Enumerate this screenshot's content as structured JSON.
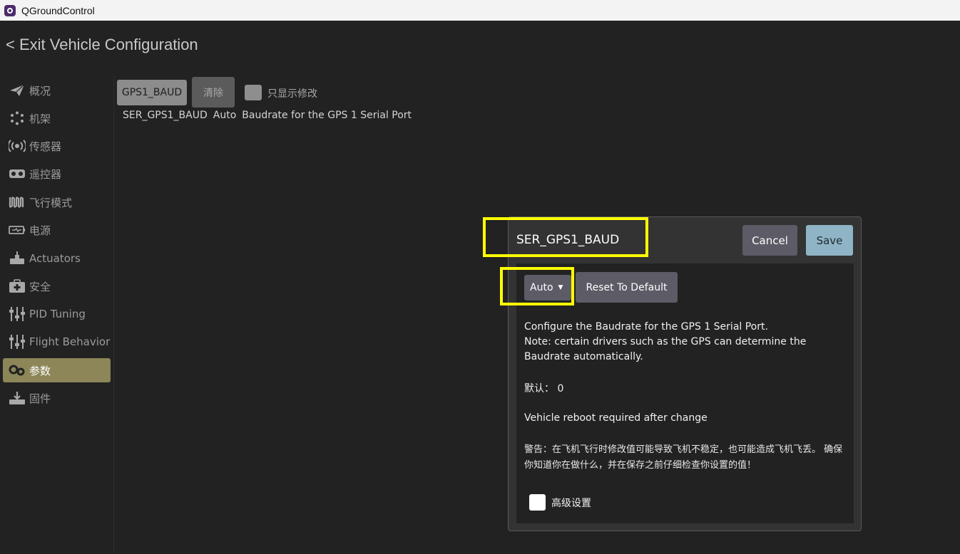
{
  "window": {
    "title": "QGroundControl"
  },
  "header": {
    "exit_label": "< Exit Vehicle Configuration"
  },
  "sidebar": {
    "items": [
      {
        "label": "概况",
        "icon": "paper-plane-icon",
        "active": false
      },
      {
        "label": "机架",
        "icon": "airframe-icon",
        "active": false
      },
      {
        "label": "传感器",
        "icon": "radio-signal-icon",
        "active": false
      },
      {
        "label": "遥控器",
        "icon": "gamepad-icon",
        "active": false
      },
      {
        "label": "飞行模式",
        "icon": "waveform-icon",
        "active": false
      },
      {
        "label": "电源",
        "icon": "battery-icon",
        "active": false
      },
      {
        "label": "Actuators",
        "icon": "actuator-icon",
        "active": false
      },
      {
        "label": "安全",
        "icon": "medkit-icon",
        "active": false
      },
      {
        "label": "PID Tuning",
        "icon": "sliders-icon",
        "active": false
      },
      {
        "label": "Flight Behavior",
        "icon": "sliders-icon",
        "active": false
      },
      {
        "label": "参数",
        "icon": "gears-icon",
        "active": true
      },
      {
        "label": "固件",
        "icon": "download-icon",
        "active": false
      }
    ]
  },
  "filter": {
    "search_button": "GPS1_BAUD",
    "clear_button": "清除",
    "only_changed_label": "只显示修改"
  },
  "param_list": [
    {
      "name": "SER_GPS1_BAUD",
      "value": "Auto",
      "description": "Baudrate for the GPS 1 Serial Port"
    }
  ],
  "dialog": {
    "title": "SER_GPS1_BAUD",
    "cancel_label": "Cancel",
    "save_label": "Save",
    "combo_value": "Auto",
    "reset_label": "Reset To Default",
    "description_line1": "Configure the Baudrate for the GPS 1 Serial Port.",
    "description_line2": "Note: certain drivers such as the GPS can determine the Baudrate automatically.",
    "default_label": "默认：",
    "default_value": "0",
    "reboot_note": "Vehicle reboot required after change",
    "warning": "警告：在飞机飞行时修改值可能导致飞机不稳定，也可能造成飞机飞丢。 确保你知道你在做什么，并在保存之前仔细检查你设置的值！",
    "advanced_label": "高级设置"
  },
  "colors": {
    "background": "#222222",
    "active_item": "#8c8659",
    "save_button": "#8fb4c6",
    "highlight": "#ffff00"
  }
}
